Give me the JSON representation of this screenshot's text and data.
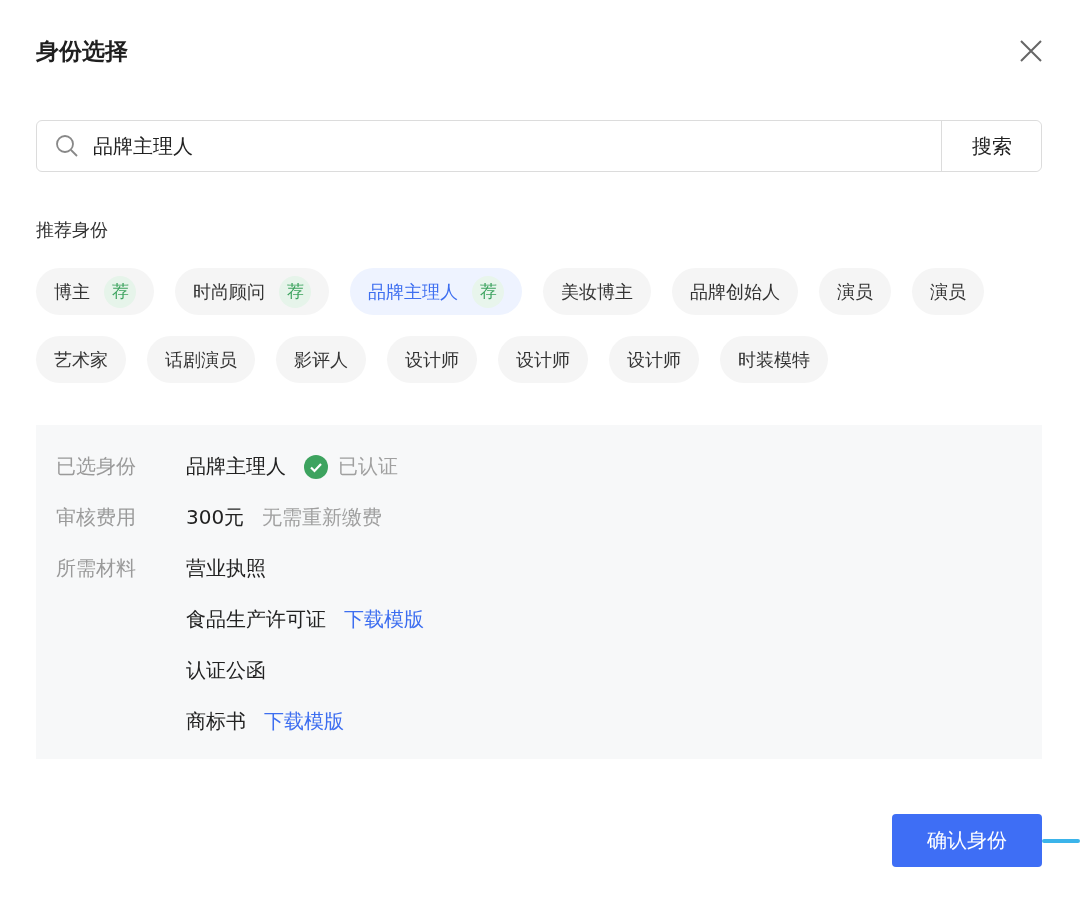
{
  "dialog": {
    "title": "身份选择"
  },
  "search": {
    "value": "品牌主理人",
    "button": "搜索"
  },
  "section_label": "推荐身份",
  "tags": [
    {
      "label": "博主",
      "badge": "荐",
      "selected": false
    },
    {
      "label": "时尚顾问",
      "badge": "荐",
      "selected": false
    },
    {
      "label": "品牌主理人",
      "badge": "荐",
      "selected": true
    },
    {
      "label": "美妆博主",
      "selected": false
    },
    {
      "label": "品牌创始人",
      "selected": false
    },
    {
      "label": "演员",
      "selected": false
    },
    {
      "label": "演员",
      "selected": false
    },
    {
      "label": "艺术家",
      "selected": false
    },
    {
      "label": "话剧演员",
      "selected": false
    },
    {
      "label": "影评人",
      "selected": false
    },
    {
      "label": "设计师",
      "selected": false
    },
    {
      "label": "设计师",
      "selected": false
    },
    {
      "label": "设计师",
      "selected": false
    },
    {
      "label": "时装模特",
      "selected": false
    }
  ],
  "summary": {
    "selected_label": "已选身份",
    "selected_value": "品牌主理人",
    "verified": true,
    "verified_text": "已认证",
    "fee_label": "审核费用",
    "fee_value": "300元",
    "fee_note": "无需重新缴费",
    "materials_label": "所需材料",
    "materials": [
      {
        "name": "营业执照"
      },
      {
        "name": "食品生产许可证",
        "link": "下载模版"
      },
      {
        "name": "认证公函"
      },
      {
        "name": "商标书",
        "link": "下载模版"
      }
    ]
  },
  "confirm_button": "确认身份"
}
